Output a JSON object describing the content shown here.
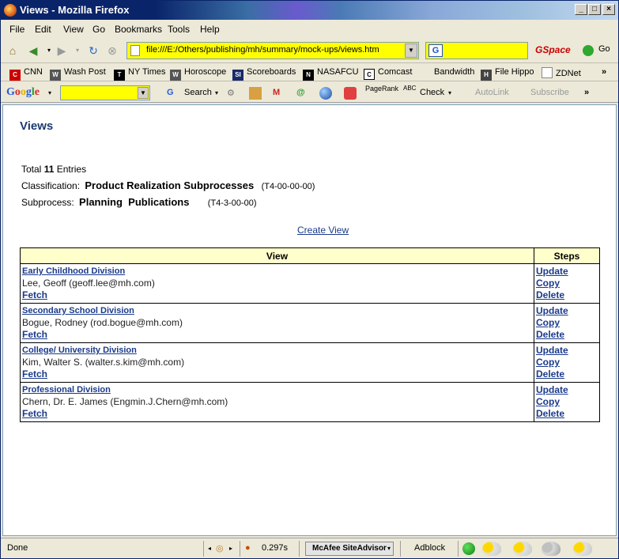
{
  "window": {
    "title": "Views - Mozilla Firefox"
  },
  "menu": [
    "File",
    "Edit",
    "View",
    "Go",
    "Bookmarks",
    "Tools",
    "Help"
  ],
  "nav": {
    "url": "file:///E:/Others/publishing/mh/summary/mock-ups/views.htm",
    "search_placeholder": "",
    "gspace_label": "GSpace",
    "go_label": "Go"
  },
  "bookmarks": [
    "CNN",
    "Wash Post",
    "NY Times",
    "Horoscope",
    "Scoreboards",
    "NASAFCU",
    "Comcast",
    "Bandwidth",
    "File Hippo",
    "ZDNet"
  ],
  "google_toolbar": {
    "logo": "Google",
    "search_label": "Search",
    "pagerank_label": "PageRank",
    "check_label": "Check",
    "autolink_label": "AutoLink",
    "subscribe_label": "Subscribe"
  },
  "page": {
    "title": "Views",
    "total_prefix": "Total",
    "total_count": "11",
    "total_suffix": "Entries",
    "classification_label": "Classification:",
    "classification_value": "Product Realization Subprocesses",
    "classification_code": "(T4-00-00-00)",
    "subprocess_label": "Subprocess:",
    "subprocess_value": "Planning  Publications",
    "subprocess_code": "(T4-3-00-00)",
    "create_view_label": "Create View",
    "table_headers": {
      "view": "View",
      "steps": "Steps"
    },
    "rows": [
      {
        "division": "Early Childhood Division",
        "person": "Lee, Geoff (geoff.lee@mh.com)",
        "fetch": "Fetch"
      },
      {
        "division": "Secondary School Division",
        "person": "Bogue, Rodney (rod.bogue@mh.com)",
        "fetch": "Fetch"
      },
      {
        "division": "College/ University Division",
        "person": "Kim, Walter S. (walter.s.kim@mh.com)",
        "fetch": "Fetch"
      },
      {
        "division": "Professional Division",
        "person": "Chern, Dr. E. James (Engmin.J.Chern@mh.com)",
        "fetch": "Fetch"
      }
    ],
    "step_labels": {
      "update": "Update",
      "copy": "Copy",
      "delete": "Delete"
    }
  },
  "status": {
    "text": "Done",
    "time": "0.297s",
    "mcafee": "McAfee SiteAdvisor",
    "adblock": "Adblock"
  }
}
